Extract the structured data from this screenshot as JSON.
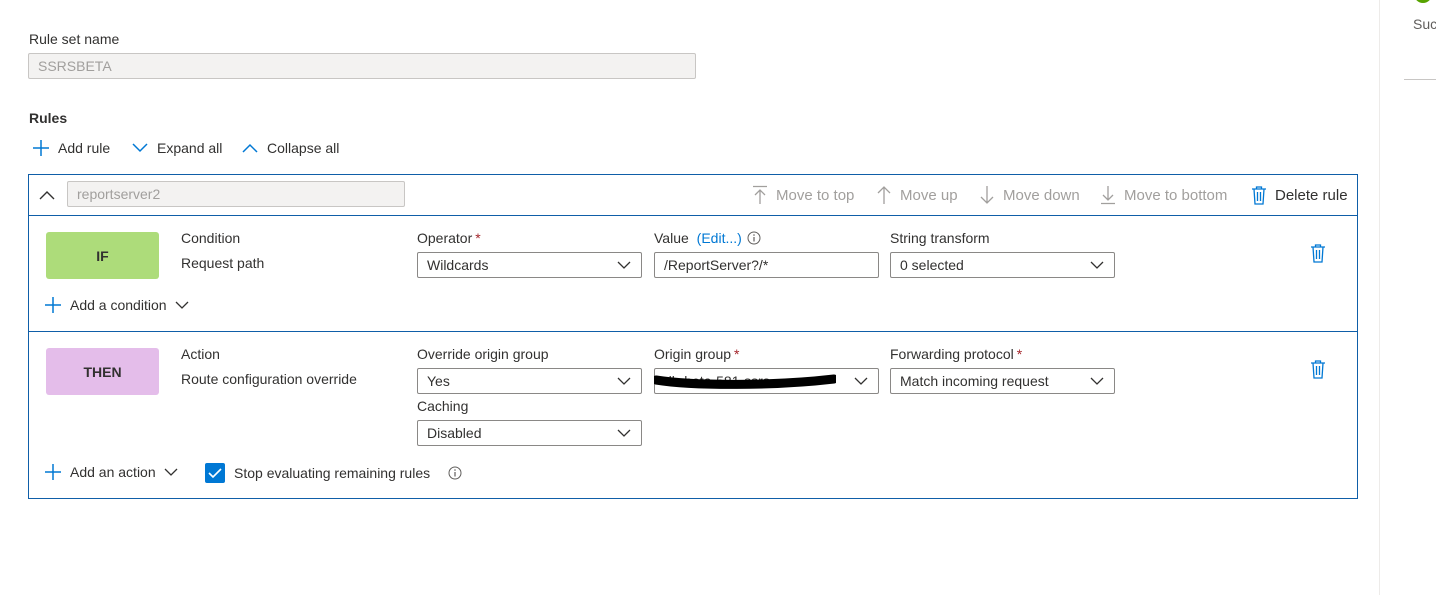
{
  "rule_set": {
    "label": "Rule set name",
    "value": "SSRSBETA"
  },
  "rules": {
    "heading": "Rules",
    "toolbar": {
      "add_rule": "Add rule",
      "expand_all": "Expand all",
      "collapse_all": "Collapse all"
    }
  },
  "rule": {
    "name": "reportserver2",
    "actions": {
      "move_to_top": "Move to top",
      "move_up": "Move up",
      "move_down": "Move down",
      "move_to_bottom": "Move to bottom",
      "delete_rule": "Delete rule"
    },
    "condition_block": {
      "badge": "IF",
      "badge_color": "#addc7a",
      "condition_label": "Condition",
      "condition_value": "Request path",
      "operator_label": "Operator",
      "operator_value": "Wildcards",
      "value_label": "Value",
      "value_edit_link": "(Edit...)",
      "value_value": "/ReportServer?/*",
      "transform_label": "String transform",
      "transform_value": "0 selected",
      "add_condition": "Add a condition"
    },
    "action_block": {
      "badge": "THEN",
      "badge_color": "#e4bdea",
      "action_label": "Action",
      "action_value": "Route configuration override",
      "override_label": "Override origin group",
      "override_value": "Yes",
      "origin_group_label": "Origin group",
      "origin_group_value": "db-beta-581-ssrs",
      "protocol_label": "Forwarding protocol",
      "protocol_value": "Match incoming request",
      "caching_label": "Caching",
      "caching_value": "Disabled",
      "add_action": "Add an action",
      "stop_evaluating_label": "Stop evaluating remaining rules",
      "stop_evaluating_checked": true
    }
  },
  "side_panel": {
    "status_text": "Suc"
  },
  "colors": {
    "accent": "#0078d4",
    "border_blue": "#0f5ea8",
    "required": "#a4262c",
    "success": "#57a300"
  }
}
